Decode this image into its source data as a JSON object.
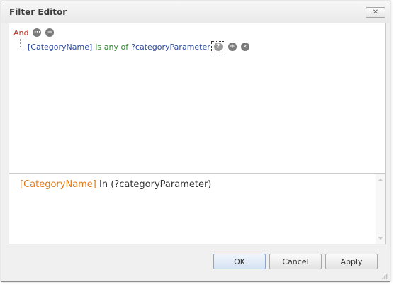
{
  "window": {
    "title": "Filter Editor",
    "close_label": "✕"
  },
  "tree": {
    "group_operator": "And",
    "group_icons": {
      "options": "ellipsis-icon",
      "add": "plus-icon"
    },
    "condition": {
      "field": "[CategoryName]",
      "operation": "Is any of",
      "value": "?categoryParameter",
      "icons": {
        "value_type": "question-icon",
        "add": "plus-icon",
        "remove": "close-icon"
      }
    }
  },
  "expression": {
    "field": "[CategoryName]",
    "rest": " In (?categoryParameter)"
  },
  "buttons": {
    "ok": "OK",
    "cancel": "Cancel",
    "apply": "Apply"
  },
  "glyphs": {
    "ellipsis": "⋯",
    "plus": "+",
    "question": "?",
    "remove": "✕"
  },
  "colors": {
    "group_operator": "#c0392b",
    "field": "#2d4ba0",
    "operation": "#2e8b2e",
    "expression_field": "#e07b1a"
  }
}
